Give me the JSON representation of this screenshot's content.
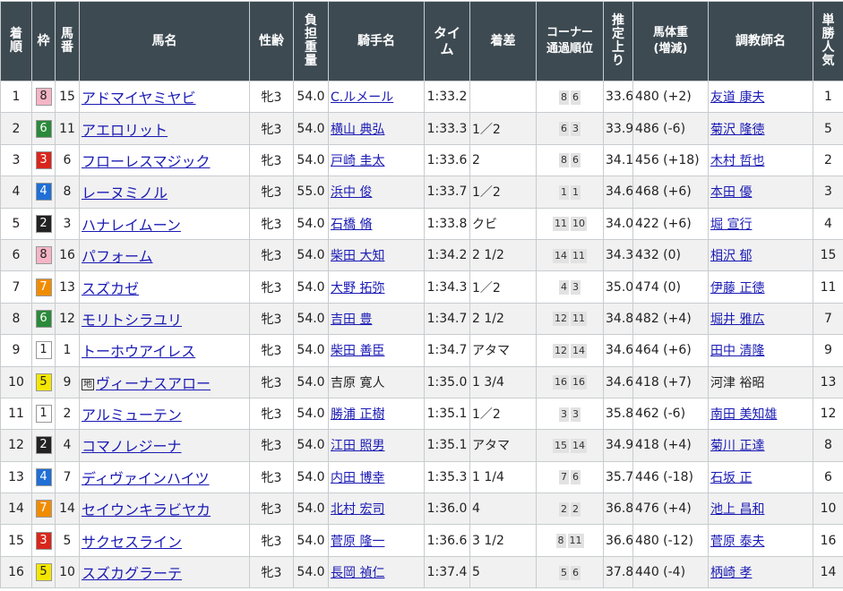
{
  "headers": {
    "rank": [
      "着",
      "順"
    ],
    "frame": "枠",
    "number": [
      "馬",
      "番"
    ],
    "horse": "馬名",
    "sexage": "性齢",
    "weight": [
      "負",
      "担",
      "重",
      "量"
    ],
    "jockey": "騎手名",
    "time": [
      "タイ",
      "ム"
    ],
    "margin": "着差",
    "corner": [
      "コーナー",
      "通過順位"
    ],
    "last3f": [
      "推",
      "定",
      "上",
      "り"
    ],
    "bodyweight": [
      "馬体重",
      "(増減)"
    ],
    "trainer": "調教師名",
    "popularity": [
      "単",
      "勝",
      "人",
      "気"
    ]
  },
  "frame_colors": {
    "1": {
      "bg": "#ffffff",
      "fg": "#222222"
    },
    "2": {
      "bg": "#222222",
      "fg": "#ffffff"
    },
    "3": {
      "bg": "#d9261c",
      "fg": "#ffffff"
    },
    "4": {
      "bg": "#1f6fd6",
      "fg": "#ffffff"
    },
    "5": {
      "bg": "#f3e700",
      "fg": "#222222"
    },
    "6": {
      "bg": "#2a8a3a",
      "fg": "#ffffff"
    },
    "7": {
      "bg": "#f08c00",
      "fg": "#ffffff"
    },
    "8": {
      "bg": "#f6b5c6",
      "fg": "#222222"
    }
  },
  "rows": [
    {
      "rank": "1",
      "frame": "8",
      "number": "15",
      "horse": "アドマイヤミヤビ",
      "local": false,
      "sexage": "牝3",
      "weight": "54.0",
      "jockey": "C.ルメール",
      "jockey_link": true,
      "time": "1:33.2",
      "margin": "",
      "corner": [
        "8",
        "6"
      ],
      "last3f": "33.6",
      "bodyweight": "480 (+2)",
      "trainer": "友道 康夫",
      "trainer_link": true,
      "popularity": "1"
    },
    {
      "rank": "2",
      "frame": "6",
      "number": "11",
      "horse": "アエロリット",
      "local": false,
      "sexage": "牝3",
      "weight": "54.0",
      "jockey": "横山 典弘",
      "jockey_link": true,
      "time": "1:33.3",
      "margin": "1／2",
      "corner": [
        "6",
        "3"
      ],
      "last3f": "33.9",
      "bodyweight": "486 (-6)",
      "trainer": "菊沢 隆徳",
      "trainer_link": true,
      "popularity": "5"
    },
    {
      "rank": "3",
      "frame": "3",
      "number": "6",
      "horse": "フローレスマジック",
      "local": false,
      "sexage": "牝3",
      "weight": "54.0",
      "jockey": "戸崎 圭太",
      "jockey_link": true,
      "time": "1:33.6",
      "margin": "2",
      "corner": [
        "8",
        "6"
      ],
      "last3f": "34.1",
      "bodyweight": "456 (+18)",
      "trainer": "木村 哲也",
      "trainer_link": true,
      "popularity": "2"
    },
    {
      "rank": "4",
      "frame": "4",
      "number": "8",
      "horse": "レーヌミノル",
      "local": false,
      "sexage": "牝3",
      "weight": "55.0",
      "jockey": "浜中 俊",
      "jockey_link": true,
      "time": "1:33.7",
      "margin": "1／2",
      "corner": [
        "1",
        "1"
      ],
      "last3f": "34.6",
      "bodyweight": "468 (+6)",
      "trainer": "本田 優",
      "trainer_link": true,
      "popularity": "3"
    },
    {
      "rank": "5",
      "frame": "2",
      "number": "3",
      "horse": "ハナレイムーン",
      "local": false,
      "sexage": "牝3",
      "weight": "54.0",
      "jockey": "石橋 脩",
      "jockey_link": true,
      "time": "1:33.8",
      "margin": "クビ",
      "corner": [
        "11",
        "10"
      ],
      "last3f": "34.0",
      "bodyweight": "422 (+6)",
      "trainer": "堀 宣行",
      "trainer_link": true,
      "popularity": "4"
    },
    {
      "rank": "6",
      "frame": "8",
      "number": "16",
      "horse": "パフォーム",
      "local": false,
      "sexage": "牝3",
      "weight": "54.0",
      "jockey": "柴田 大知",
      "jockey_link": true,
      "time": "1:34.2",
      "margin": "2 1/2",
      "corner": [
        "14",
        "11"
      ],
      "last3f": "34.3",
      "bodyweight": "432 (0)",
      "trainer": "相沢 郁",
      "trainer_link": true,
      "popularity": "15"
    },
    {
      "rank": "7",
      "frame": "7",
      "number": "13",
      "horse": "スズカゼ",
      "local": false,
      "sexage": "牝3",
      "weight": "54.0",
      "jockey": "大野 拓弥",
      "jockey_link": true,
      "time": "1:34.3",
      "margin": "1／2",
      "corner": [
        "4",
        "3"
      ],
      "last3f": "35.0",
      "bodyweight": "474 (0)",
      "trainer": "伊藤 正徳",
      "trainer_link": true,
      "popularity": "11"
    },
    {
      "rank": "8",
      "frame": "6",
      "number": "12",
      "horse": "モリトシラユリ",
      "local": false,
      "sexage": "牝3",
      "weight": "54.0",
      "jockey": "吉田 豊",
      "jockey_link": true,
      "time": "1:34.7",
      "margin": "2 1/2",
      "corner": [
        "12",
        "11"
      ],
      "last3f": "34.8",
      "bodyweight": "482 (+4)",
      "trainer": "堀井 雅広",
      "trainer_link": true,
      "popularity": "7"
    },
    {
      "rank": "9",
      "frame": "1",
      "number": "1",
      "horse": "トーホウアイレス",
      "local": false,
      "sexage": "牝3",
      "weight": "54.0",
      "jockey": "柴田 善臣",
      "jockey_link": true,
      "time": "1:34.7",
      "margin": "アタマ",
      "corner": [
        "12",
        "14"
      ],
      "last3f": "34.6",
      "bodyweight": "464 (+6)",
      "trainer": "田中 清隆",
      "trainer_link": true,
      "popularity": "9"
    },
    {
      "rank": "10",
      "frame": "5",
      "number": "9",
      "horse": "ヴィーナスアロー",
      "local": true,
      "local_mark": "地",
      "sexage": "牝3",
      "weight": "54.0",
      "jockey": "吉原 寛人",
      "jockey_link": false,
      "time": "1:35.0",
      "margin": "1 3/4",
      "corner": [
        "16",
        "16"
      ],
      "last3f": "34.6",
      "bodyweight": "418 (+7)",
      "trainer": "河津 裕昭",
      "trainer_link": false,
      "popularity": "13"
    },
    {
      "rank": "11",
      "frame": "1",
      "number": "2",
      "horse": "アルミューテン",
      "local": false,
      "sexage": "牝3",
      "weight": "54.0",
      "jockey": "勝浦 正樹",
      "jockey_link": true,
      "time": "1:35.1",
      "margin": "1／2",
      "corner": [
        "3",
        "3"
      ],
      "last3f": "35.8",
      "bodyweight": "462 (-6)",
      "trainer": "南田 美知雄",
      "trainer_link": true,
      "popularity": "12"
    },
    {
      "rank": "12",
      "frame": "2",
      "number": "4",
      "horse": "コマノレジーナ",
      "local": false,
      "sexage": "牝3",
      "weight": "54.0",
      "jockey": "江田 照男",
      "jockey_link": true,
      "time": "1:35.1",
      "margin": "アタマ",
      "corner": [
        "15",
        "14"
      ],
      "last3f": "34.9",
      "bodyweight": "418 (+4)",
      "trainer": "菊川 正達",
      "trainer_link": true,
      "popularity": "8"
    },
    {
      "rank": "13",
      "frame": "4",
      "number": "7",
      "horse": "ディヴァインハイツ",
      "local": false,
      "sexage": "牝3",
      "weight": "54.0",
      "jockey": "内田 博幸",
      "jockey_link": true,
      "time": "1:35.3",
      "margin": "1 1/4",
      "corner": [
        "7",
        "6"
      ],
      "last3f": "35.7",
      "bodyweight": "446 (-18)",
      "trainer": "石坂 正",
      "trainer_link": true,
      "popularity": "6"
    },
    {
      "rank": "14",
      "frame": "7",
      "number": "14",
      "horse": "セイウンキラビヤカ",
      "local": false,
      "sexage": "牝3",
      "weight": "54.0",
      "jockey": "北村 宏司",
      "jockey_link": true,
      "time": "1:36.0",
      "margin": "4",
      "corner": [
        "2",
        "2"
      ],
      "last3f": "36.8",
      "bodyweight": "476 (+4)",
      "trainer": "池上 昌和",
      "trainer_link": true,
      "popularity": "10"
    },
    {
      "rank": "15",
      "frame": "3",
      "number": "5",
      "horse": "サクセスライン",
      "local": false,
      "sexage": "牝3",
      "weight": "54.0",
      "jockey": "菅原 隆一",
      "jockey_link": true,
      "time": "1:36.6",
      "margin": "3 1/2",
      "corner": [
        "8",
        "11"
      ],
      "last3f": "36.6",
      "bodyweight": "480 (-12)",
      "trainer": "菅原 泰夫",
      "trainer_link": true,
      "popularity": "16"
    },
    {
      "rank": "16",
      "frame": "5",
      "number": "10",
      "horse": "スズカグラーテ",
      "local": false,
      "sexage": "牝3",
      "weight": "54.0",
      "jockey": "長岡 禎仁",
      "jockey_link": true,
      "time": "1:37.4",
      "margin": "5",
      "corner": [
        "5",
        "6"
      ],
      "last3f": "37.8",
      "bodyweight": "440 (-4)",
      "trainer": "柄崎 孝",
      "trainer_link": true,
      "popularity": "14"
    }
  ]
}
